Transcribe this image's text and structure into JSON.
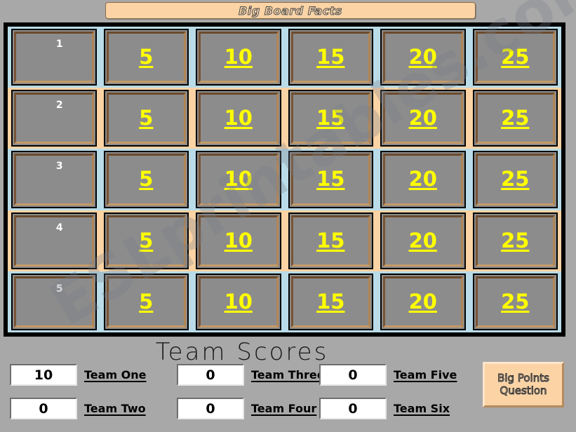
{
  "title": {
    "text": "Big Board Facts"
  },
  "board": {
    "row_numbers": [
      "1",
      "2",
      "3",
      "4",
      "5"
    ],
    "column_values": [
      "5",
      "10",
      "15",
      "20",
      "25"
    ],
    "rows": [
      {
        "number": "1",
        "separator": "blue",
        "values": [
          "5",
          "10",
          "15",
          "20",
          "25"
        ]
      },
      {
        "number": "2",
        "separator": "peach",
        "values": [
          "5",
          "10",
          "15",
          "20",
          "25"
        ]
      },
      {
        "number": "3",
        "separator": "blue",
        "values": [
          "5",
          "10",
          "15",
          "20",
          "25"
        ]
      },
      {
        "number": "4",
        "separator": "peach",
        "values": [
          "5",
          "10",
          "15",
          "20",
          "25"
        ]
      },
      {
        "number": "5",
        "separator": "blue",
        "values": [
          "5",
          "10",
          "15",
          "20",
          "25"
        ]
      }
    ]
  },
  "scores": {
    "heading": "Team Scores",
    "teams": [
      {
        "score": "10",
        "label": "Team One"
      },
      {
        "score": "0",
        "label": "Team Two"
      },
      {
        "score": "0",
        "label": "Team Three"
      },
      {
        "score": "0",
        "label": "Team Four"
      },
      {
        "score": "0",
        "label": "Team Five"
      },
      {
        "score": "0",
        "label": "Team Six"
      }
    ]
  },
  "big_points_button": {
    "line1": "Big Points",
    "line2": "Question"
  },
  "watermark": {
    "text": "ESLprintables.com"
  },
  "colors": {
    "background": "#a8a8a8",
    "board": "#000000",
    "cell": "#8c8c8c",
    "cell_border": "#6b4a2b",
    "value_text": "#ffff00",
    "separator_blue": "#b9dce8",
    "separator_peach": "#fbd3a4",
    "accent_peach": "#fbd3a4"
  }
}
